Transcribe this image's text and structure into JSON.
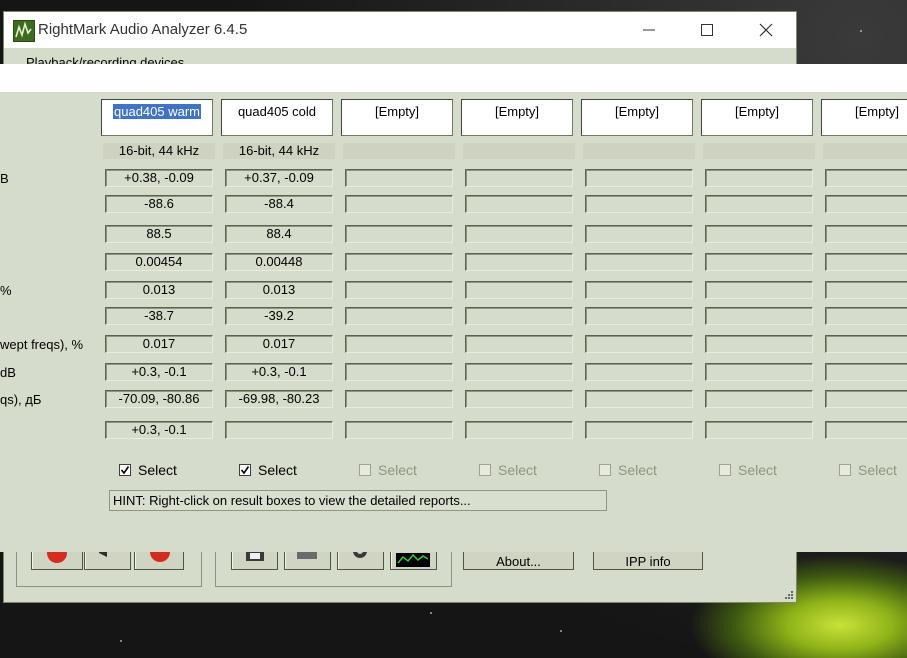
{
  "main_window": {
    "title": "RightMark Audio Analyzer 6.4.5",
    "group_label": "Playback/recording devices",
    "about_label": "About...",
    "ipp_label": "IPP info"
  },
  "compare": {
    "row_labels": [
      "B",
      "",
      "",
      "",
      "%",
      "",
      "wept freqs), %",
      "dB",
      "qs), дБ",
      ""
    ],
    "columns": [
      {
        "header": "quad405 warm",
        "format": "16-bit, 44 kHz",
        "selected": true,
        "values": [
          "+0.38, -0.09",
          "-88.6",
          "88.5",
          "0.00454",
          "0.013",
          "-38.7",
          "0.017",
          "+0.3, -0.1",
          "-70.09, -80.86",
          "+0.3, -0.1"
        ]
      },
      {
        "header": "quad405 cold",
        "format": "16-bit, 44 kHz",
        "selected": true,
        "values": [
          "+0.37, -0.09",
          "-88.4",
          "88.4",
          "0.00448",
          "0.013",
          "-39.2",
          "0.017",
          "+0.3, -0.1",
          "-69.98, -80.23",
          ""
        ]
      },
      {
        "header": "[Empty]",
        "format": "",
        "selected": false,
        "values": [
          "",
          "",
          "",
          "",
          "",
          "",
          "",
          "",
          "",
          ""
        ]
      },
      {
        "header": "[Empty]",
        "format": "",
        "selected": false,
        "values": [
          "",
          "",
          "",
          "",
          "",
          "",
          "",
          "",
          "",
          ""
        ]
      },
      {
        "header": "[Empty]",
        "format": "",
        "selected": false,
        "values": [
          "",
          "",
          "",
          "",
          "",
          "",
          "",
          "",
          "",
          ""
        ]
      },
      {
        "header": "[Empty]",
        "format": "",
        "selected": false,
        "values": [
          "",
          "",
          "",
          "",
          "",
          "",
          "",
          "",
          "",
          ""
        ]
      },
      {
        "header": "[Empty]",
        "format": "",
        "selected": false,
        "values": [
          "",
          "",
          "",
          "",
          "",
          "",
          "",
          "",
          "",
          ""
        ]
      }
    ],
    "select_label": "Select",
    "hint": "HINT: Right-click on result boxes to view the detailed reports..."
  },
  "icons": {
    "app": "rmaa-logo-icon",
    "minimize": "minimize-icon",
    "maximize": "maximize-icon",
    "close": "close-icon"
  },
  "colors": {
    "window_bg": "#d6dccb",
    "selection": "#3f73c9",
    "wallpaper_tent": "#c8e23a"
  }
}
